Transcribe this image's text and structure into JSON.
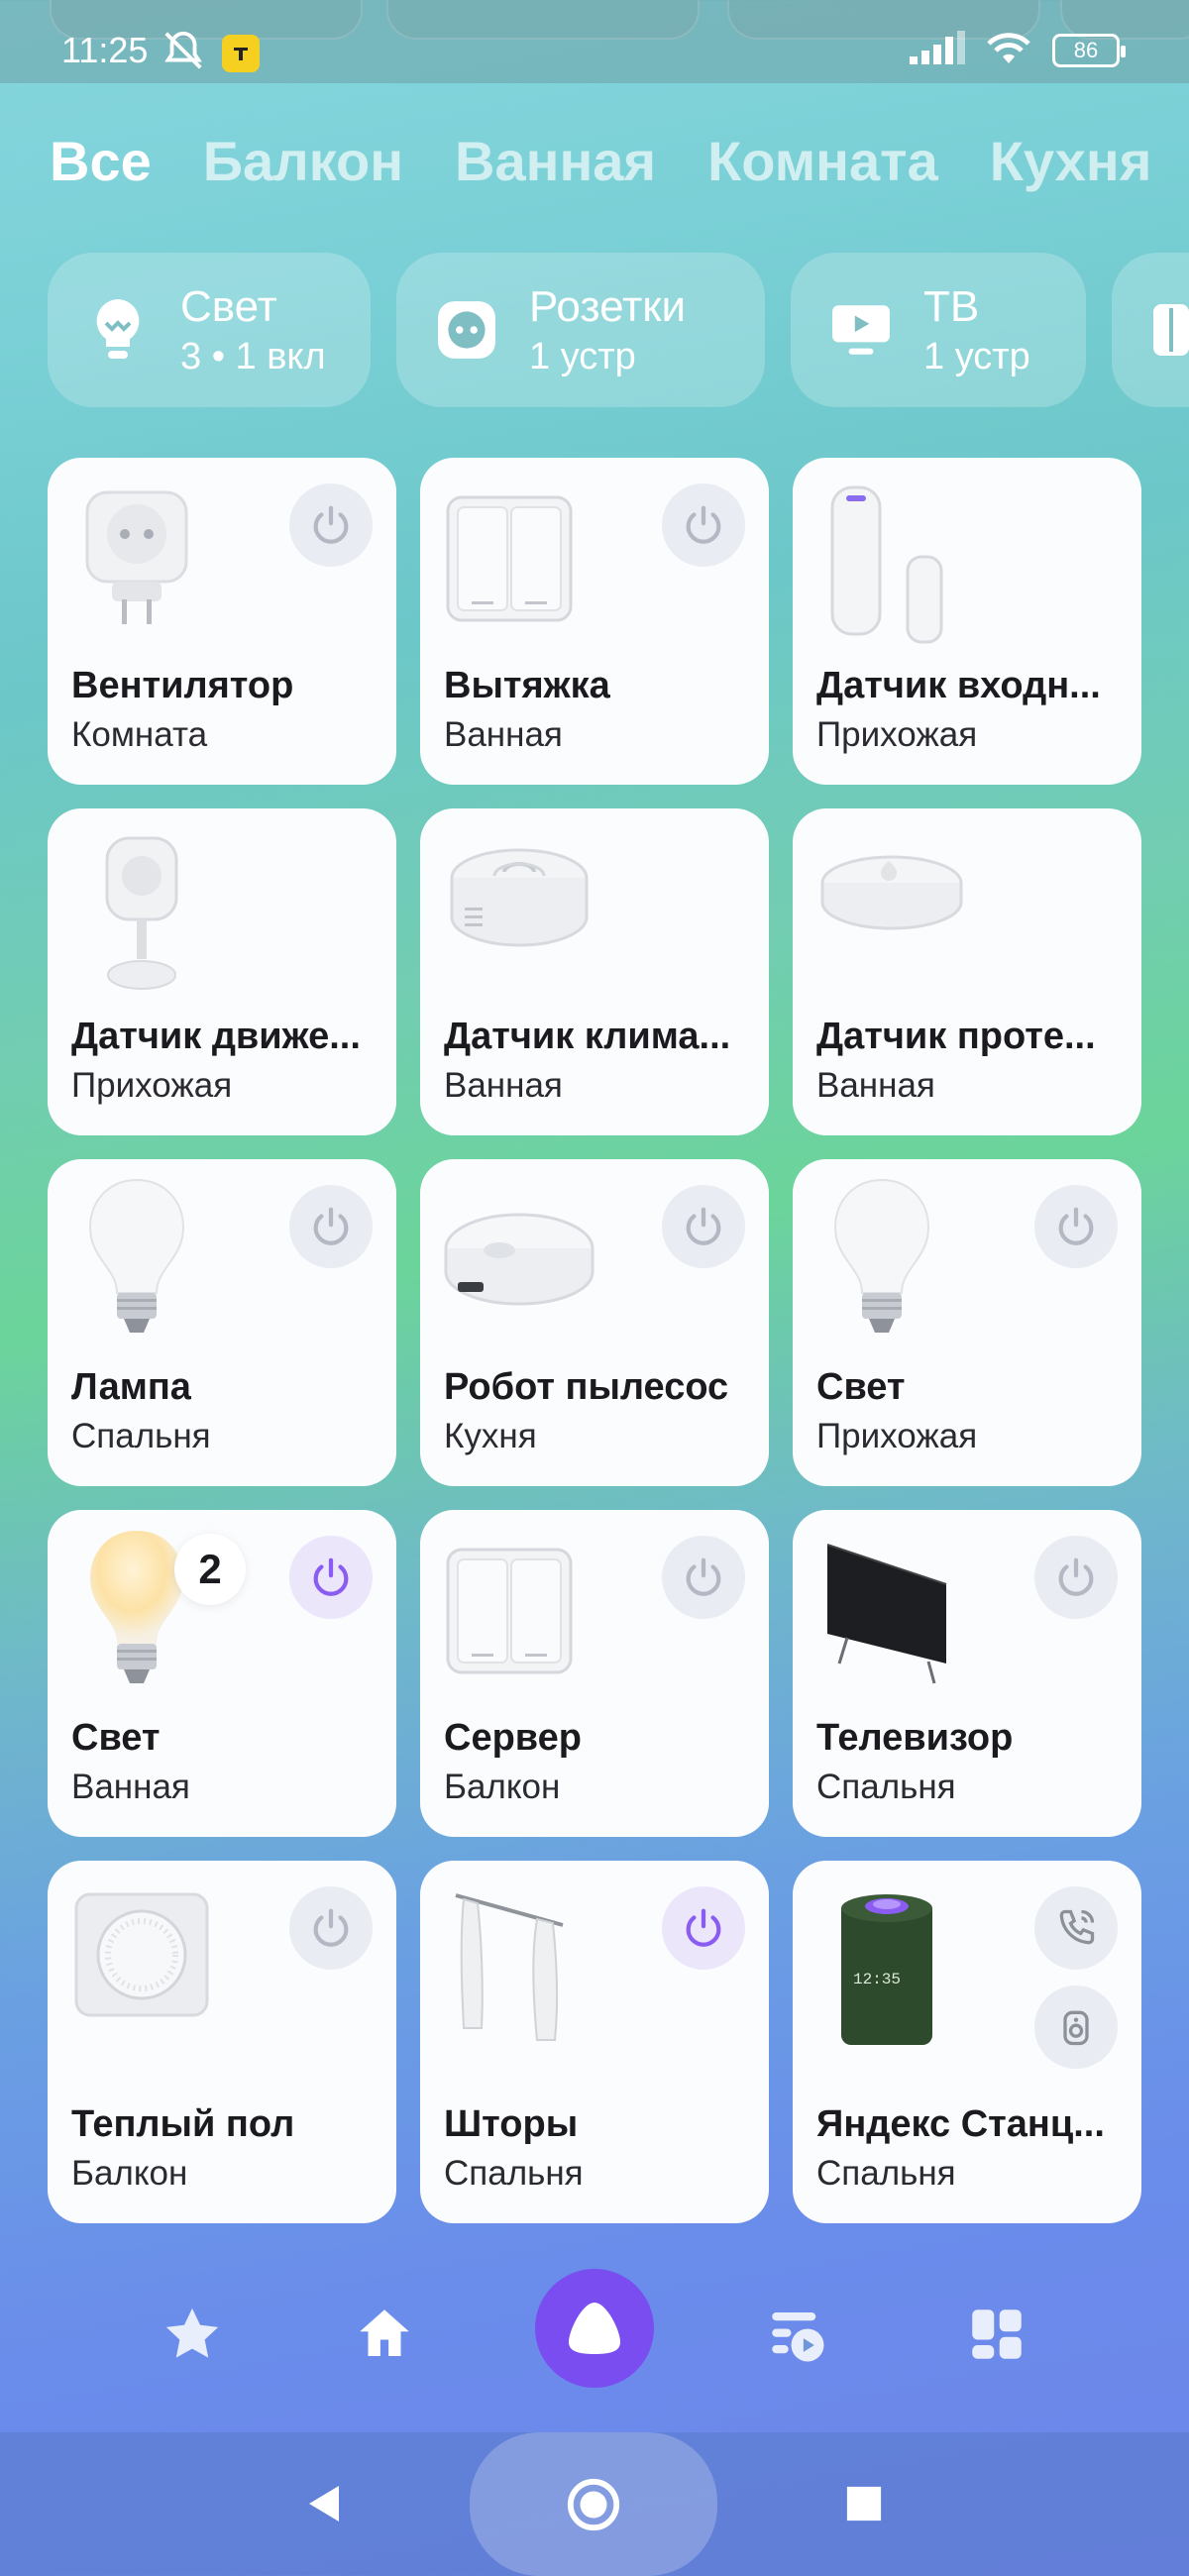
{
  "status_bar": {
    "time": "11:25",
    "battery": "86"
  },
  "tabs": [
    {
      "label": "Все",
      "active": true
    },
    {
      "label": "Балкон"
    },
    {
      "label": "Ванная"
    },
    {
      "label": "Комната"
    },
    {
      "label": "Кухня"
    }
  ],
  "chips": [
    {
      "title": "Свет",
      "subtitle": "3 • 1 вкл",
      "icon": "bulb-icon"
    },
    {
      "title": "Розетки",
      "subtitle": "1 устр",
      "icon": "socket-icon"
    },
    {
      "title": "ТВ",
      "subtitle": "1 устр",
      "icon": "tv-icon"
    }
  ],
  "devices": [
    {
      "name": "Вентилятор",
      "room": "Комната",
      "image": "smart-plug",
      "power": "off"
    },
    {
      "name": "Вытяжка",
      "room": "Ванная",
      "image": "wall-switch",
      "power": "off"
    },
    {
      "name": "Датчик входн...",
      "room": "Прихожая",
      "image": "door-sensor"
    },
    {
      "name": "Датчик движе...",
      "room": "Прихожая",
      "image": "motion-sensor"
    },
    {
      "name": "Датчик клима...",
      "room": "Ванная",
      "image": "climate-sensor"
    },
    {
      "name": "Датчик проте...",
      "room": "Ванная",
      "image": "leak-sensor"
    },
    {
      "name": "Лампа",
      "room": "Спальня",
      "image": "bulb",
      "power": "off"
    },
    {
      "name": "Робот пылесос",
      "room": "Кухня",
      "image": "robot-vacuum",
      "power": "off"
    },
    {
      "name": "Свет",
      "room": "Прихожая",
      "image": "bulb",
      "power": "off"
    },
    {
      "name": "Свет",
      "room": "Ванная",
      "image": "bulb-warm",
      "power": "on",
      "badge": "2"
    },
    {
      "name": "Сервер",
      "room": "Балкон",
      "image": "wall-switch",
      "power": "off"
    },
    {
      "name": "Телевизор",
      "room": "Спальня",
      "image": "tv",
      "power": "off"
    },
    {
      "name": "Теплый пол",
      "room": "Балкон",
      "image": "thermostat",
      "power": "off"
    },
    {
      "name": "Шторы",
      "room": "Спальня",
      "image": "curtains",
      "power": "on"
    },
    {
      "name": "Яндекс Станц...",
      "room": "Спальня",
      "image": "yandex-station",
      "actions": [
        "call-icon",
        "intercom-icon"
      ]
    }
  ],
  "bottom_nav": [
    "star-icon",
    "home-icon",
    "alice-icon",
    "playlist-icon",
    "grid-icon"
  ],
  "colors": {
    "accent": "#7a4df0",
    "power_on": "#8a5cf2",
    "power_off": "#b4b8c3"
  }
}
